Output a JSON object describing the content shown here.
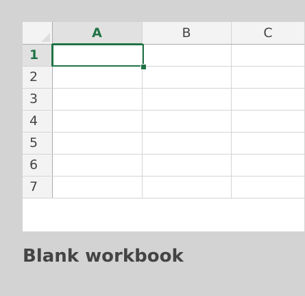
{
  "template": {
    "caption": "Blank workbook",
    "columns": [
      "A",
      "B",
      "C"
    ],
    "rows": [
      "1",
      "2",
      "3",
      "4",
      "5",
      "6",
      "7"
    ],
    "active_cell": "A1"
  },
  "colors": {
    "tile_bg": "#d3d3d3",
    "accent": "#217346",
    "header_bg": "#f3f3f3",
    "gridline": "#d4d4d4"
  },
  "icons": {
    "corner": "select-all-triangle-icon"
  }
}
